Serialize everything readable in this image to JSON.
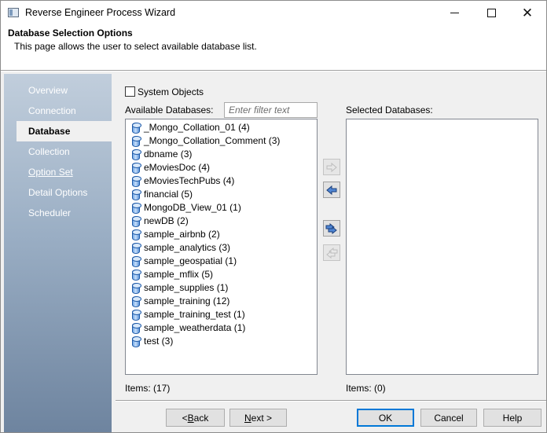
{
  "window": {
    "title": "Reverse Engineer Process Wizard"
  },
  "header": {
    "title": "Database Selection Options",
    "description": "This page allows the user to select available database list."
  },
  "sidebar": {
    "items": [
      {
        "label": "Overview"
      },
      {
        "label": "Connection"
      },
      {
        "label": "Database"
      },
      {
        "label": "Collection"
      },
      {
        "label": "Option Set"
      },
      {
        "label": "Detail Options"
      },
      {
        "label": "Scheduler"
      }
    ],
    "active": "Database"
  },
  "options": {
    "system_objects_label": "System Objects",
    "system_objects_checked": false
  },
  "available": {
    "label": "Available Databases:",
    "filter_placeholder": "Enter filter text",
    "items": [
      "_Mongo_Collation_01 (4)",
      "_Mongo_Collation_Comment (3)",
      "dbname (3)",
      "eMoviesDoc (4)",
      "eMoviesTechPubs (4)",
      "financial (5)",
      "MongoDB_View_01 (1)",
      "newDB (2)",
      "sample_airbnb (2)",
      "sample_analytics (3)",
      "sample_geospatial (1)",
      "sample_mflix (5)",
      "sample_supplies (1)",
      "sample_training (12)",
      "sample_training_test (1)",
      "sample_weatherdata (1)",
      "test (3)"
    ],
    "count_text": "Items: (17)"
  },
  "selected": {
    "label": "Selected Databases:",
    "items": [],
    "count_text": "Items: (0)"
  },
  "move_buttons": [
    {
      "icon": "arrow-right-icon",
      "enabled": false
    },
    {
      "icon": "arrow-left-icon",
      "enabled": true
    },
    {
      "icon": "double-arrow-right-icon",
      "enabled": true
    },
    {
      "icon": "double-arrow-left-icon",
      "enabled": false
    }
  ],
  "buttons": {
    "back": {
      "pre": "< ",
      "hotkey": "B",
      "post": "ack"
    },
    "next": {
      "pre": "",
      "hotkey": "N",
      "post": "ext >"
    },
    "ok": "OK",
    "cancel": "Cancel",
    "help": "Help"
  }
}
